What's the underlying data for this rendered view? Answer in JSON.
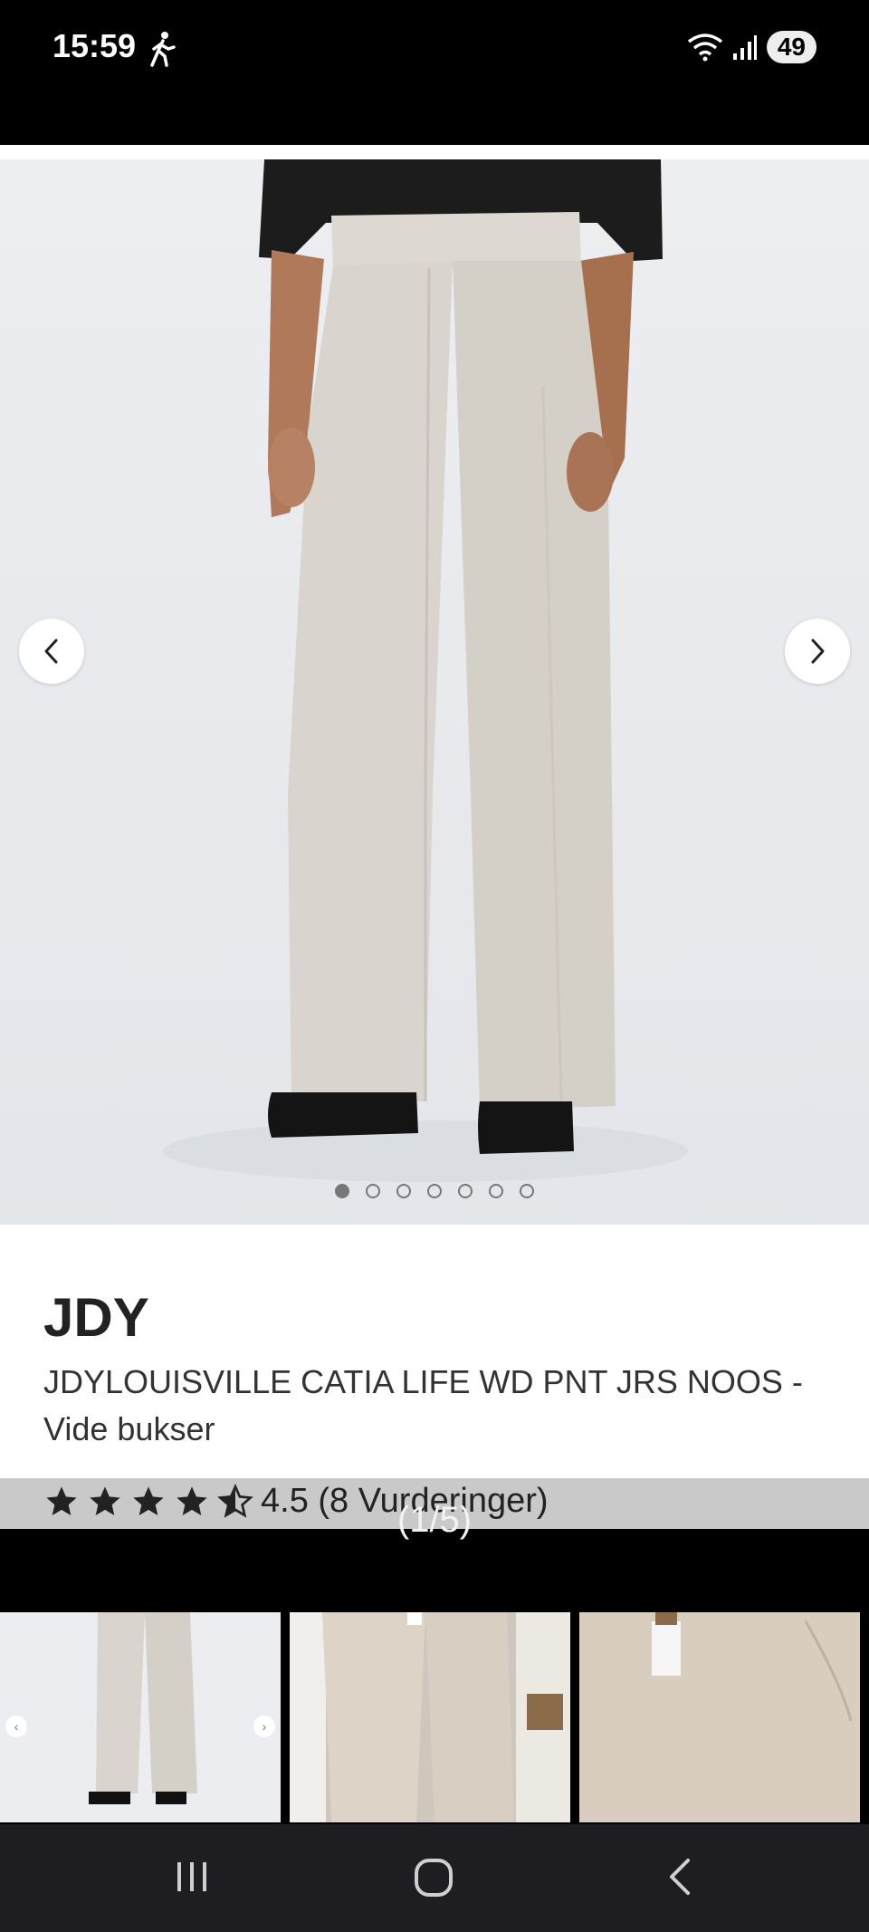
{
  "status": {
    "time": "15:59",
    "battery": "49",
    "wifi_label": "5"
  },
  "gallery": {
    "icons": {
      "prev": "chevron-left-icon",
      "next": "chevron-right-icon"
    },
    "dot_count": 7,
    "active_dot": 0
  },
  "product": {
    "brand": "JDY",
    "title": "JDYLOUISVILLE CATIA LIFE WD PNT JRS NOOS - Vide bukser",
    "rating": 4.5,
    "rating_text": "4.5 (8 Vurderinger)"
  },
  "lightbox": {
    "counter": "(1/5)"
  },
  "thumbnails": [
    {
      "name": "thumbnail-1"
    },
    {
      "name": "thumbnail-2"
    },
    {
      "name": "thumbnail-3"
    }
  ],
  "colors": {
    "pants": "#d9d4cd",
    "background": "#e9ebee",
    "rating_bar": "#c9c9c9"
  }
}
